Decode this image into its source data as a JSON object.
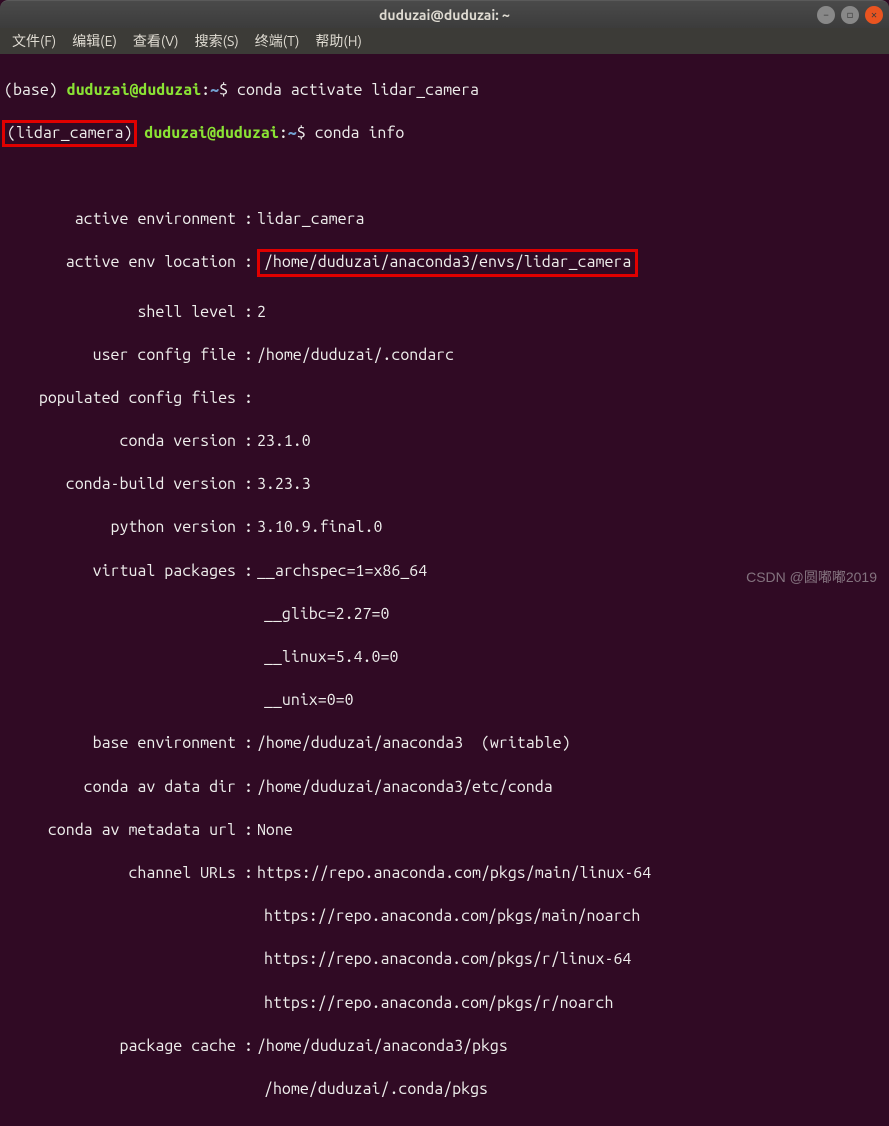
{
  "window": {
    "title": "duduzai@duduzai: ~"
  },
  "menu": {
    "file": "文件(F)",
    "edit": "编辑(E)",
    "view": "查看(V)",
    "search": "搜索(S)",
    "terminal": "终端(T)",
    "help": "帮助(H)"
  },
  "lines": {
    "p1_env": "(base)",
    "p1_user": "duduzai@duduzai",
    "p1_path": "~",
    "p1_cmd": "conda activate lidar_camera",
    "p2_env": "(lidar_camera)",
    "p2_user": "duduzai@duduzai",
    "p2_path": "~",
    "p2_cmd": "conda info"
  },
  "info": {
    "active_env_k": "active environment",
    "active_env_v": "lidar_camera",
    "active_loc_k": "active env location",
    "active_loc_v": "/home/duduzai/anaconda3/envs/lidar_camera",
    "shell_level_k": "shell level",
    "shell_level_v": "2",
    "user_config_k": "user config file",
    "user_config_v": "/home/duduzai/.condarc",
    "pop_config_k": "populated config files",
    "pop_config_v": "",
    "conda_ver_k": "conda version",
    "conda_ver_v": "23.1.0",
    "conda_build_k": "conda-build version",
    "conda_build_v": "3.23.3",
    "python_ver_k": "python version",
    "python_ver_v": "3.10.9.final.0",
    "virt_pkg_k": "virtual packages",
    "virt_pkg_v": "__archspec=1=x86_64",
    "virt_pkg_v2": "__glibc=2.27=0",
    "virt_pkg_v3": "__linux=5.4.0=0",
    "virt_pkg_v4": "__unix=0=0",
    "base_env_k": "base environment",
    "base_env_v": "/home/duduzai/anaconda3  (writable)",
    "av_data_k": "conda av data dir",
    "av_data_v": "/home/duduzai/anaconda3/etc/conda",
    "av_meta_k": "conda av metadata url",
    "av_meta_v": "None",
    "ch_urls_k": "channel URLs",
    "ch_urls_v": "https://repo.anaconda.com/pkgs/main/linux-64",
    "ch_urls_v2": "https://repo.anaconda.com/pkgs/main/noarch",
    "ch_urls_v3": "https://repo.anaconda.com/pkgs/r/linux-64",
    "ch_urls_v4": "https://repo.anaconda.com/pkgs/r/noarch",
    "pkg_cache_k": "package cache",
    "pkg_cache_v": "/home/duduzai/anaconda3/pkgs",
    "pkg_cache_v2": "/home/duduzai/.conda/pkgs"
  },
  "watermark": "CSDN @圆嘟嘟2019"
}
